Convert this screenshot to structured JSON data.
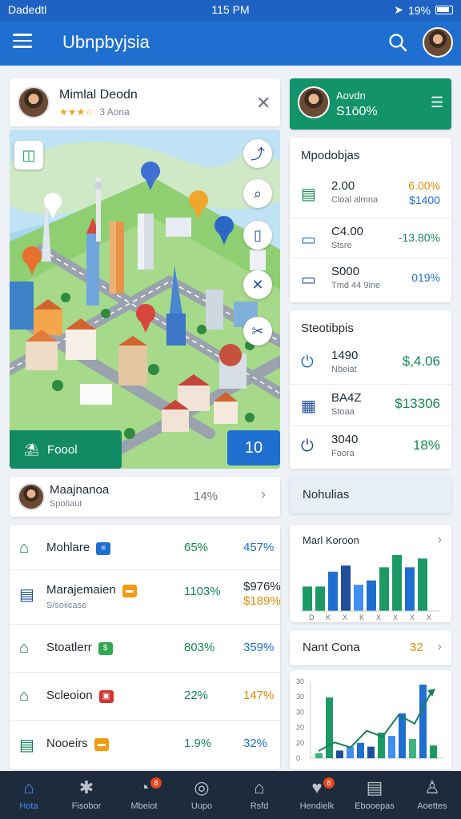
{
  "status": {
    "carrier": "Dadedtl",
    "time": "115 PM",
    "battery": "19%"
  },
  "appbar": {
    "title": "Ubnpbyjsia"
  },
  "profile": {
    "name": "Mimlal Deodn",
    "rating": "★★★☆",
    "sub": "3 Aona"
  },
  "map": {
    "food_label": "Foool",
    "count_label": "10"
  },
  "agent": {
    "line1": "Aovdn",
    "line2": "S1ō0%"
  },
  "money": {
    "title": "Mpodobjas",
    "rows": [
      {
        "value": "2.00",
        "sub": "Cloal almna",
        "pct": "6.00%",
        "pct2": "$1400",
        "pct_color": "#e08a00",
        "pct2_color": "#1f6fd1"
      },
      {
        "value": "C4.00",
        "sub": "Stsre",
        "pct": "-13.80%",
        "pct_color": "#138a4f"
      },
      {
        "value": "S000",
        "sub": "Tmd 44 9ine",
        "pct": "019%",
        "pct_color": "#1f6fd1"
      }
    ]
  },
  "stats": {
    "title": "Steotibpis",
    "rows": [
      {
        "value": "1490",
        "sub": "Nbeiat",
        "pct": "$,4.06"
      },
      {
        "value": "BA4Z",
        "sub": "Stoaa",
        "pct": "$13306"
      },
      {
        "value": "3040",
        "sub": "Foora",
        "pct": "18%"
      }
    ]
  },
  "student": {
    "name": "Maajnanoa",
    "sub": "Spotiaut",
    "pct": "14%"
  },
  "list": [
    {
      "label": "Mohlare",
      "sub": "",
      "a": "65%",
      "b": "457%",
      "badge_color": "#1f6fd1",
      "b_color": "#1f6fd1"
    },
    {
      "label": "Marajemaien",
      "sub": "S/soiicase",
      "a": "1103%",
      "b": "$976%",
      "b2": "$189%",
      "badge_color": "#f29b11",
      "b_color": "#1f2a37"
    },
    {
      "label": "Stoatlerr",
      "sub": "",
      "a": "803%",
      "b": "359%",
      "badge_color": "#2fa84f",
      "b_color": "#1f6fd1"
    },
    {
      "label": "Scleoion",
      "sub": "",
      "a": "22%",
      "b": "147%",
      "badge_color": "#d6332f",
      "b_color": "#e08a00"
    },
    {
      "label": "Nooeirs",
      "sub": "",
      "a": "1.9%",
      "b": "32%",
      "badge_color": "#f29b11",
      "b_color": "#1f6fd1"
    }
  ],
  "notif": {
    "title": "Nohulias"
  },
  "bars1": {
    "title": "Marl Koroon",
    "categories": [
      "D",
      "K",
      "X",
      "K",
      "X",
      "X",
      "X",
      "X"
    ]
  },
  "nant": {
    "title": "Nant Cona",
    "num": "32"
  },
  "chart_data": [
    {
      "type": "bar",
      "title": "Marl Koroon",
      "categories": [
        "D",
        "K",
        "X",
        "K",
        "X",
        "X",
        "X",
        "X"
      ],
      "values": [
        28,
        28,
        45,
        52,
        30,
        35,
        50,
        64,
        50,
        60
      ]
    },
    {
      "type": "bar",
      "y_ticks": [
        "30",
        "30",
        "30",
        "20",
        "20",
        "0"
      ],
      "values": [
        8,
        95,
        12,
        18,
        24,
        18,
        40,
        35,
        70,
        30,
        115,
        20
      ],
      "trend": [
        10,
        22,
        15,
        38,
        30,
        60,
        48,
        90
      ]
    }
  ],
  "bnav": [
    {
      "label": "Hota",
      "icon": "⌂",
      "active": true
    },
    {
      "label": "Fisobor",
      "icon": "✱",
      "badge": ""
    },
    {
      "label": "Mbeiot",
      "icon": "◔",
      "badge": "8"
    },
    {
      "label": "Uupo",
      "icon": "◎"
    },
    {
      "label": "Rsfd",
      "icon": "⌂"
    },
    {
      "label": "Hendielk",
      "icon": "♥",
      "badge": "8"
    },
    {
      "label": "Ebooepas",
      "icon": "▤"
    },
    {
      "label": "Aoettes",
      "icon": "♙"
    }
  ]
}
